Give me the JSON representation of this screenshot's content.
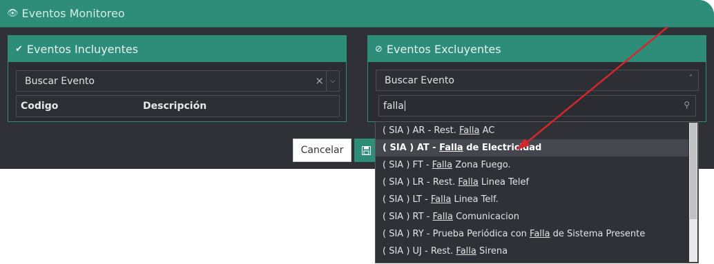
{
  "window": {
    "title": "Eventos Monitoreo",
    "icon": "eye-icon"
  },
  "included": {
    "title": "Eventos Incluyentes",
    "icon": "check-circle-icon",
    "select_placeholder": "Buscar Evento",
    "clear_glyph": "×",
    "columns": [
      "Codigo",
      "Descripción"
    ]
  },
  "excluded": {
    "title": "Eventos Excluyentes",
    "icon": "ban-circle-icon",
    "select_placeholder": "Buscar Evento",
    "search_value": "falla",
    "options": [
      {
        "pre": "( SIA ) AR - Rest. ",
        "match": "Falla",
        "post": " AC",
        "highlighted": false
      },
      {
        "pre": "( SIA ) AT - ",
        "match": "Falla",
        "post": " de Electricidad",
        "highlighted": true
      },
      {
        "pre": "( SIA ) FT - ",
        "match": "Falla",
        "post": " Zona Fuego.",
        "highlighted": false
      },
      {
        "pre": "( SIA ) LR - Rest. ",
        "match": "Falla",
        "post": " Linea Telef",
        "highlighted": false
      },
      {
        "pre": "( SIA ) LT - ",
        "match": "Falla",
        "post": " Linea Telf.",
        "highlighted": false
      },
      {
        "pre": "( SIA ) RT - ",
        "match": "Falla",
        "post": " Comunicacion",
        "highlighted": false
      },
      {
        "pre": "( SIA ) RY - Prueba Periódica con ",
        "match": "Falla",
        "post": " de Sistema Presente",
        "highlighted": false
      },
      {
        "pre": "( SIA ) UJ - Rest. ",
        "match": "Falla",
        "post": " Sirena",
        "highlighted": false
      }
    ]
  },
  "actions": {
    "cancel_label": "Cancelar",
    "save_icon": "save-icon"
  },
  "colors": {
    "accent": "#2e8d79",
    "panel_bg": "#2f3137",
    "arrow": "#d6262c"
  }
}
